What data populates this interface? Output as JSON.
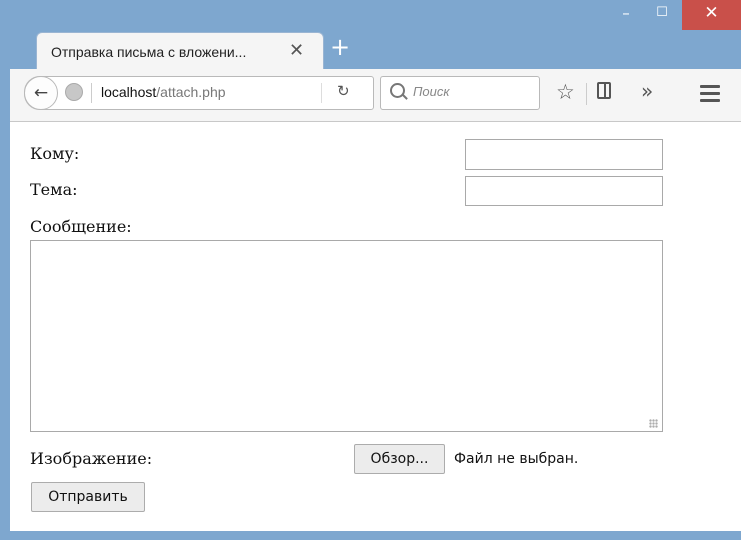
{
  "window": {
    "minimize": "–",
    "maximize": "☐",
    "close": "✕"
  },
  "tab": {
    "title": "Отправка письма с вложени...",
    "close": "✕",
    "new_tab": "+"
  },
  "navbar": {
    "back": "←",
    "url_host": "localhost",
    "url_path": "/attach.php",
    "reload": "↻",
    "search_placeholder": "Поиск",
    "bookmark": "☆",
    "overflow": "»"
  },
  "form": {
    "to_label": "Кому:",
    "to_value": "",
    "subject_label": "Тема:",
    "subject_value": "",
    "message_label": "Сообщение:",
    "message_value": "",
    "image_label": "Изображение:",
    "browse_button": "Обзор...",
    "file_status": "Файл не выбран.",
    "submit_button": "Отправить"
  }
}
